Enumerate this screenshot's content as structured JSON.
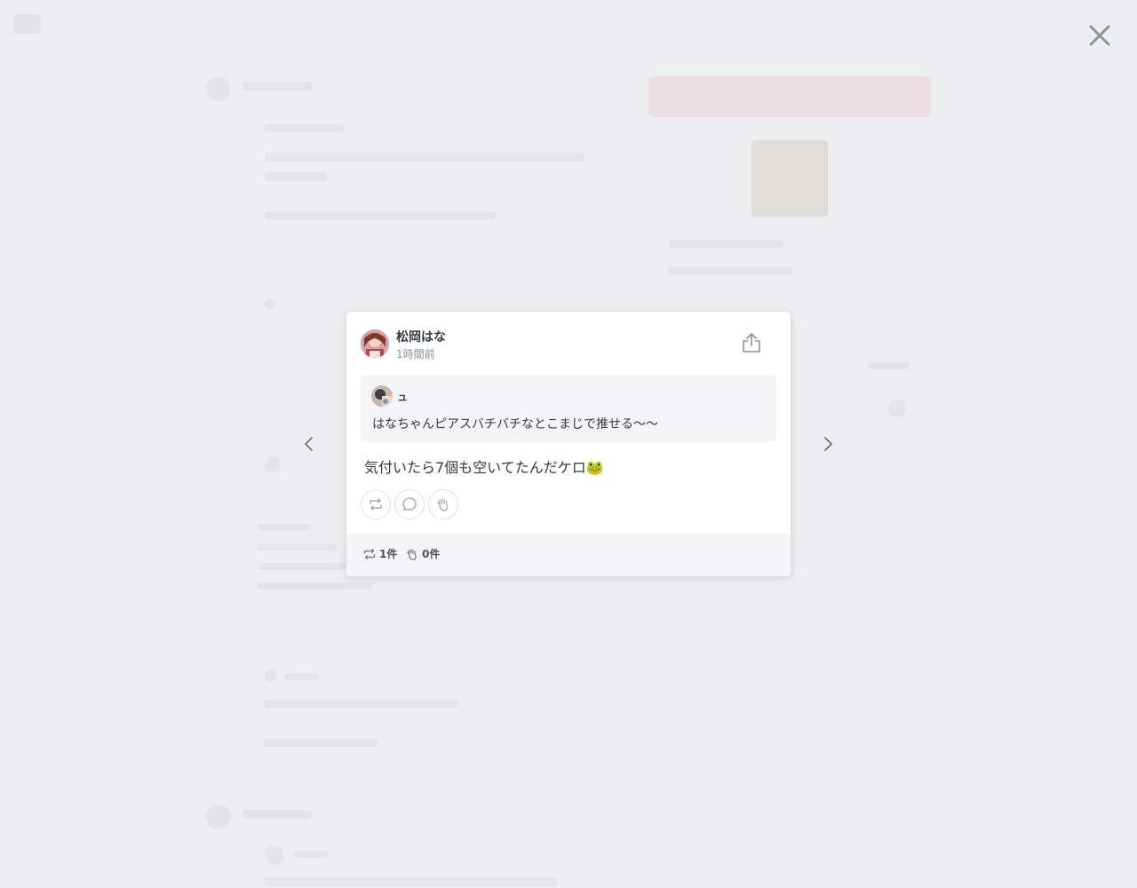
{
  "post": {
    "author": "松岡はな",
    "time": "1時間前",
    "quote": {
      "author": "ュ",
      "text": "はなちゃんピアスバチバチなとこまじで推せる〜〜"
    },
    "text": "気付いたら7個も空いてたんだケロ🐸"
  },
  "stats": {
    "reposts": "1件",
    "claps": "0件"
  },
  "icons": {
    "close": "close-icon",
    "share": "share-icon",
    "prev": "chevron-left-icon",
    "next": "chevron-right-icon",
    "repost": "repost-icon",
    "comment": "comment-icon",
    "clap": "clap-icon"
  },
  "colors": {
    "overlay": "#eceef0",
    "card": "#ffffff",
    "quote_bg": "#f3f5f7",
    "text": "#333b42",
    "muted": "#8a9299"
  }
}
